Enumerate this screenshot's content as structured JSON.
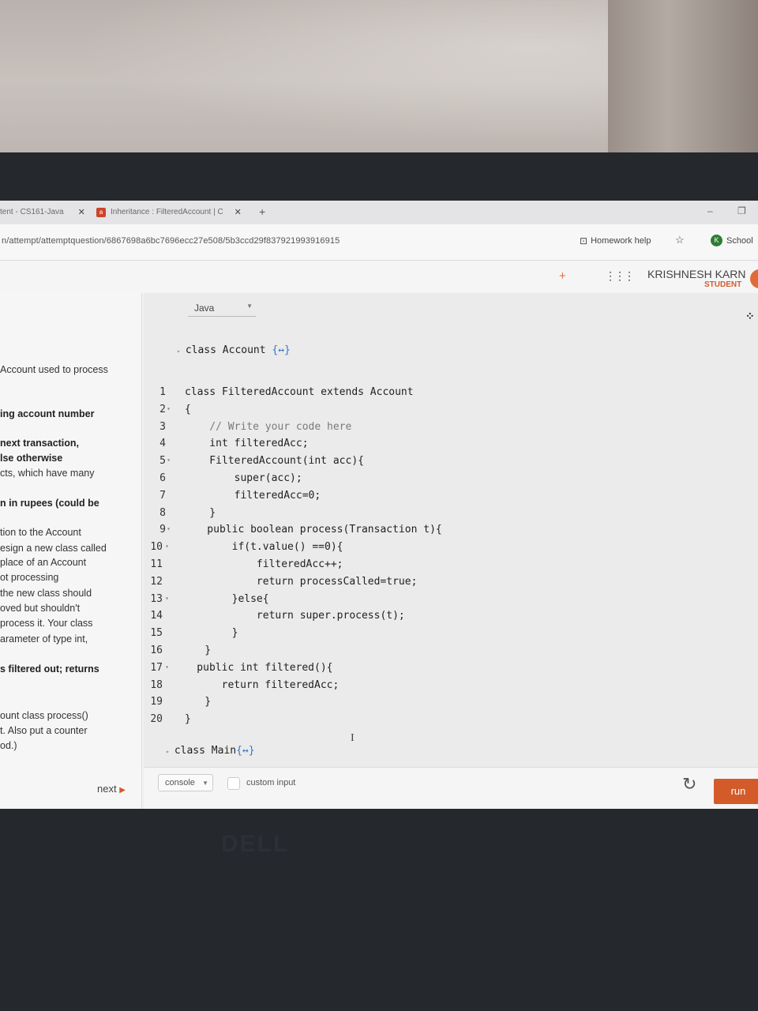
{
  "browser": {
    "tabs": [
      {
        "label": "tent - CS161-Java"
      },
      {
        "label": "Inheritance : FilteredAccount | C"
      }
    ],
    "url": "n/attempt/attemptquestion/6867698a6bc7696ecc27e508/5b3ccd29f837921993916915",
    "homework_help": "Homework help",
    "school_label": "School",
    "school_initial": "K"
  },
  "header": {
    "user_name": "KRISHNESH KARN",
    "user_role": "STUDENT"
  },
  "question": {
    "lines": [
      {
        "text": "Account used to process",
        "bold": false
      },
      {
        "text": "ing account number",
        "bold": true
      },
      {
        "text": "next transaction,",
        "bold": true
      },
      {
        "text": "lse otherwise",
        "bold": true
      },
      {
        "text": "cts, which have many",
        "bold": false
      },
      {
        "text": "n in rupees (could be",
        "bold": true
      },
      {
        "text": "tion to the Account",
        "bold": false
      },
      {
        "text": "esign a new class called",
        "bold": false
      },
      {
        "text": " place of an Account",
        "bold": false
      },
      {
        "text": "ot processing",
        "bold": false
      },
      {
        "text": "the new class should",
        "bold": false
      },
      {
        "text": "oved but shouldn't",
        "bold": false
      },
      {
        "text": "process it. Your class",
        "bold": false
      },
      {
        "text": "arameter of type int,",
        "bold": false
      },
      {
        "text": "s filtered out; returns",
        "bold": true
      },
      {
        "text": "ount class process()",
        "bold": false
      },
      {
        "text": "t. Also put a counter",
        "bold": false
      },
      {
        "text": "od.)",
        "bold": false
      }
    ],
    "next_label": "next"
  },
  "editor": {
    "language": "Java",
    "collapsed_top": "class Account ",
    "collapsed_top_fold": "{↔}",
    "line_numbers": [
      "1",
      "2",
      "3",
      "4",
      "5",
      "6",
      "7",
      "8",
      "9",
      "10",
      "11",
      "12",
      "13",
      "14",
      "15",
      "16",
      "17",
      "18",
      "19",
      "20"
    ],
    "code_lines": [
      "class FilteredAccount extends Account",
      "{",
      "    // Write your code here",
      "    int filteredAcc;",
      "    FilteredAccount(int acc){",
      "        super(acc);",
      "        filteredAcc=0;",
      "    }",
      "    public boolean process(Transaction t){",
      "        if(t.value() ==0){",
      "            filteredAcc++;",
      "            return processCalled=true;",
      "        }else{",
      "            return super.process(t);",
      "        }",
      "    }",
      "    public int filtered(){",
      "        return filteredAcc;",
      "    }",
      "}"
    ],
    "collapsed_bottom": "class Main",
    "collapsed_bottom_fold": "{↔}"
  },
  "bottom": {
    "console_label": "console",
    "custom_input_label": "custom input",
    "run_label": "run"
  },
  "colors": {
    "accent": "#d35b2a",
    "background": "#f1f1f1",
    "editor_bg": "#ebebeb"
  }
}
